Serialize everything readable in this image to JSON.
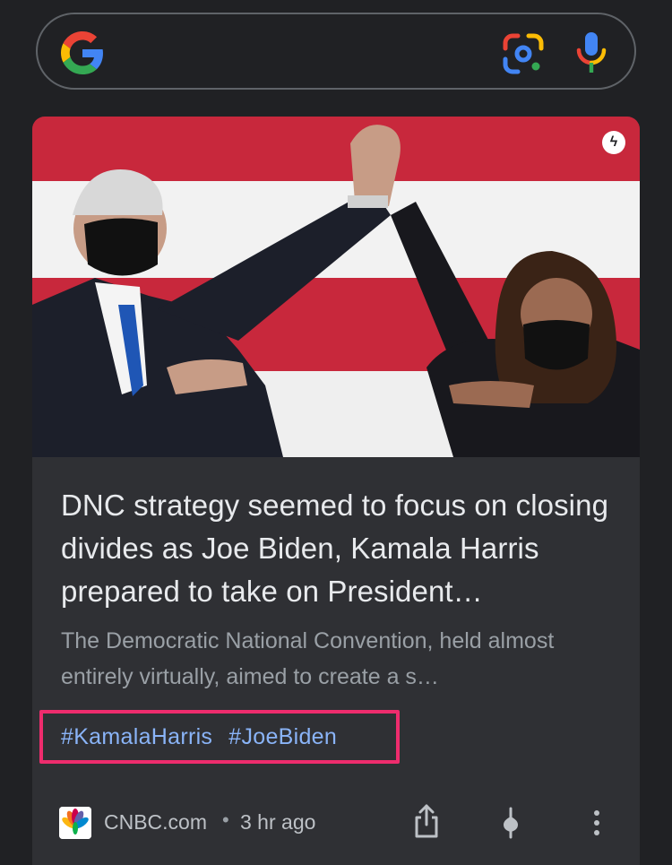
{
  "search": {
    "placeholder": ""
  },
  "article": {
    "headline": "DNC strategy seemed to focus on closing divides as Joe Biden, Kamala Harris prepared to take on President…",
    "snippet": "The Democratic National Convention, held almost entirely virtually, aimed to create a s…",
    "tags": [
      "#KamalaHarris",
      "#JoeBiden"
    ],
    "source": "CNBC.com",
    "separator": "•",
    "time_ago": "3 hr ago",
    "amp_badge": "ϟ"
  },
  "icons": {
    "logo": "google-g-icon",
    "lens": "google-lens-icon",
    "mic": "microphone-icon",
    "share": "share-icon",
    "mute": "mute-icon",
    "more": "more-vert-icon"
  },
  "colors": {
    "background": "#202124",
    "card": "#2f3034",
    "tag": "#8ab4f8",
    "highlight_border": "#ee2c6d",
    "flag_red": "#c8283c",
    "flag_white": "#f2f2f2"
  }
}
